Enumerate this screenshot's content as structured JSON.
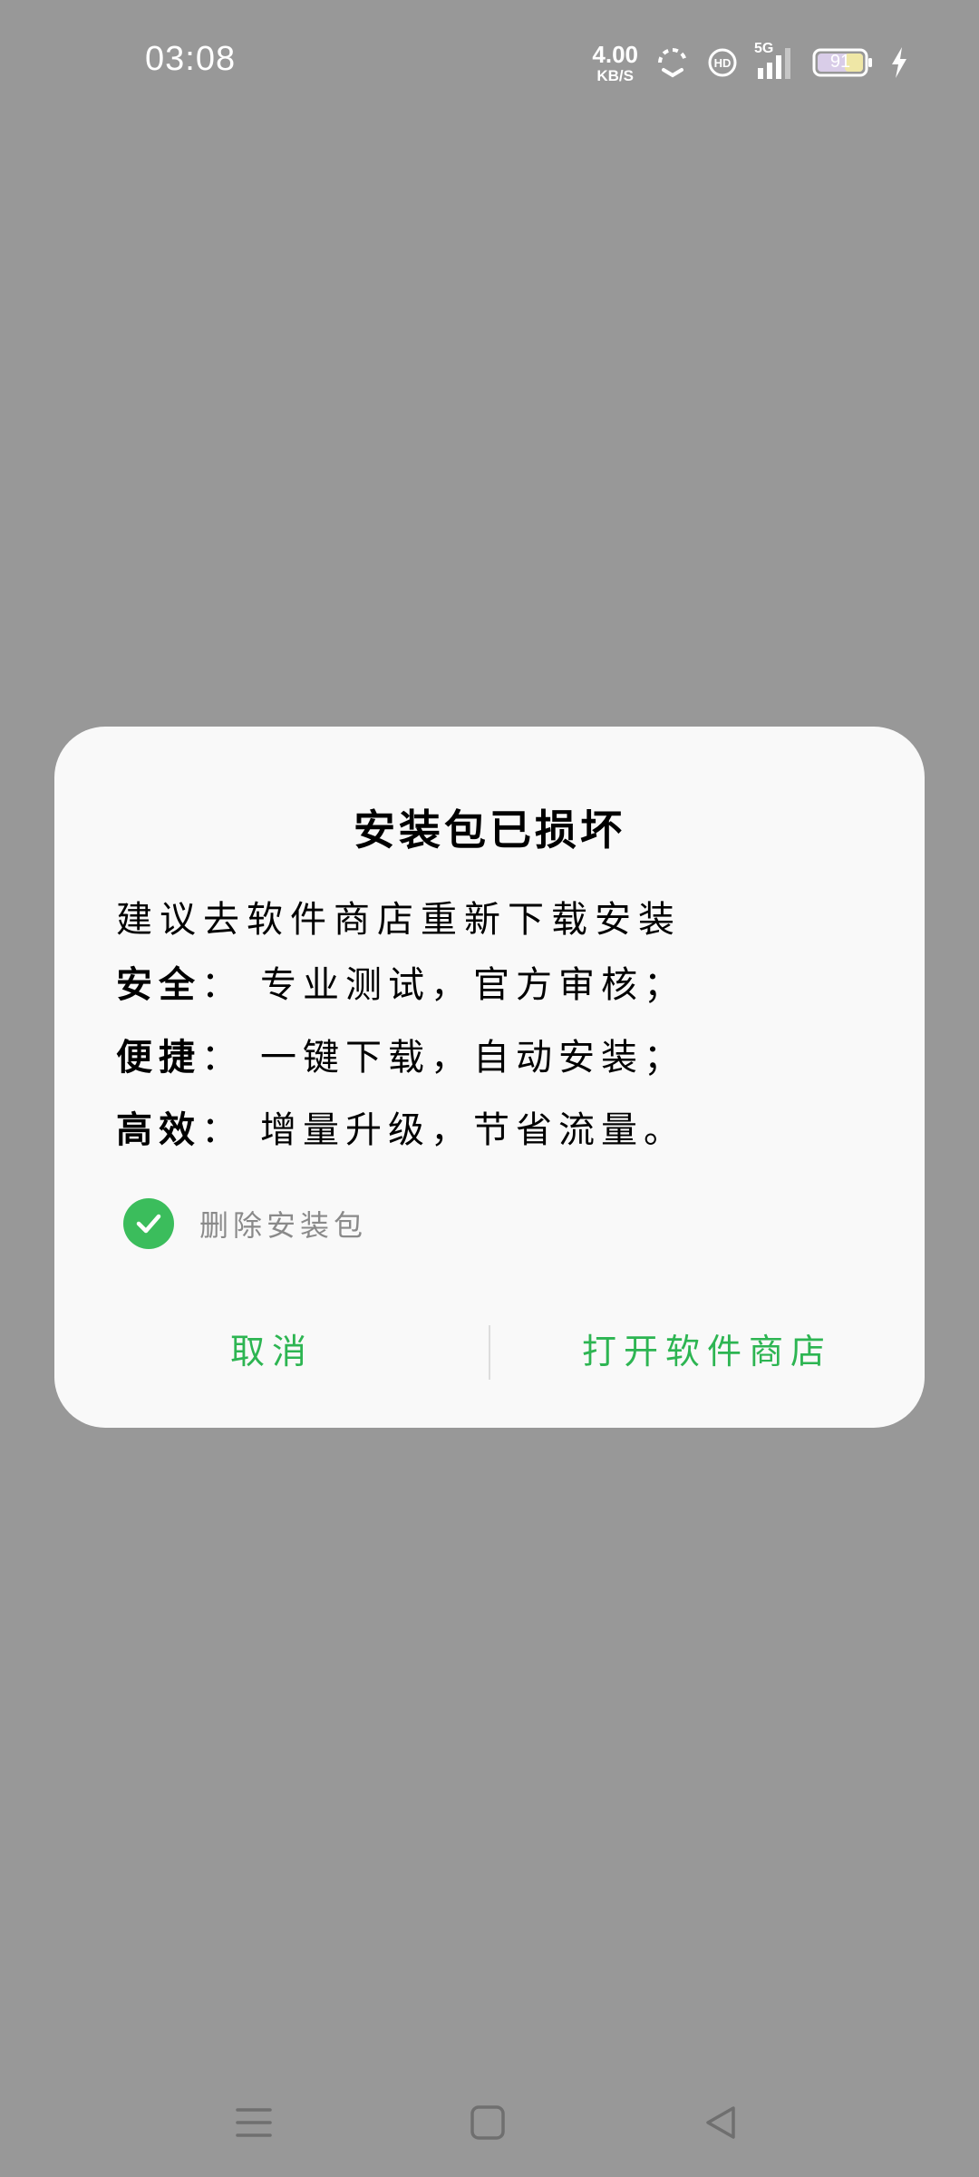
{
  "status_bar": {
    "time": "03:08",
    "net_speed_value": "4.00",
    "net_speed_unit": "KB/S",
    "network_type": "5G",
    "battery_level": "91"
  },
  "dialog": {
    "title": "安装包已损坏",
    "intro": "建议去软件商店重新下载安装",
    "features": [
      {
        "key": "安全",
        "sep": "：",
        "value": "专业测试，官方审核；"
      },
      {
        "key": "便捷",
        "sep": "：",
        "value": "一键下载，自动安装；"
      },
      {
        "key": "高效",
        "sep": "：",
        "value": "增量升级，节省流量。"
      }
    ],
    "checkbox_label": "删除安装包",
    "checkbox_checked": true,
    "cancel_label": "取消",
    "open_store_label": "打开软件商店"
  },
  "colors": {
    "accent": "#2db552",
    "check": "#3bbd5c",
    "overlay": "#989898",
    "dialog_bg": "#f9f9f9"
  }
}
